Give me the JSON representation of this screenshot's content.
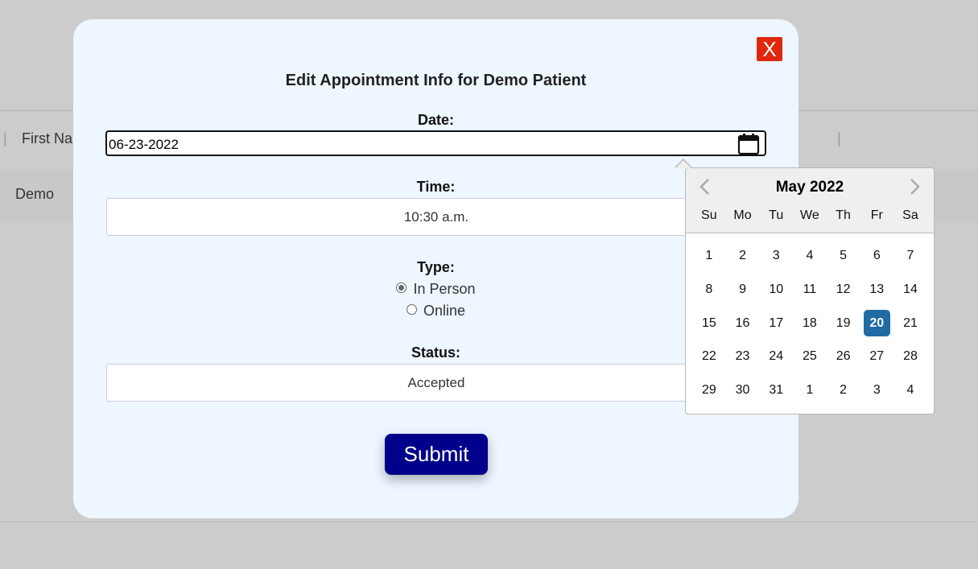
{
  "background": {
    "header_first_name": "First Na",
    "row_first_name": "Demo"
  },
  "modal": {
    "close_label": "X",
    "title": "Edit Appointment Info for Demo Patient",
    "date_label": "Date:",
    "date_value": "06-23-2022",
    "time_label": "Time:",
    "time_value": "10:30 a.m.",
    "type_label": "Type:",
    "type_options": [
      {
        "label": "In Person",
        "selected": true
      },
      {
        "label": "Online",
        "selected": false
      }
    ],
    "status_label": "Status:",
    "status_value": "Accepted",
    "submit_label": "Submit"
  },
  "datepicker": {
    "month_year": "May 2022",
    "weekdays": [
      "Su",
      "Mo",
      "Tu",
      "We",
      "Th",
      "Fr",
      "Sa"
    ],
    "weeks": [
      [
        "1",
        "2",
        "3",
        "4",
        "5",
        "6",
        "7"
      ],
      [
        "8",
        "9",
        "10",
        "11",
        "12",
        "13",
        "14"
      ],
      [
        "15",
        "16",
        "17",
        "18",
        "19",
        "20",
        "21"
      ],
      [
        "22",
        "23",
        "24",
        "25",
        "26",
        "27",
        "28"
      ],
      [
        "29",
        "30",
        "31",
        "1",
        "2",
        "3",
        "4"
      ]
    ],
    "selected_day": "20"
  },
  "colors": {
    "close_button": "#e0280f",
    "submit_button": "#00008b",
    "selected_day": "#216ba5",
    "modal_background": "#eef6ff"
  }
}
